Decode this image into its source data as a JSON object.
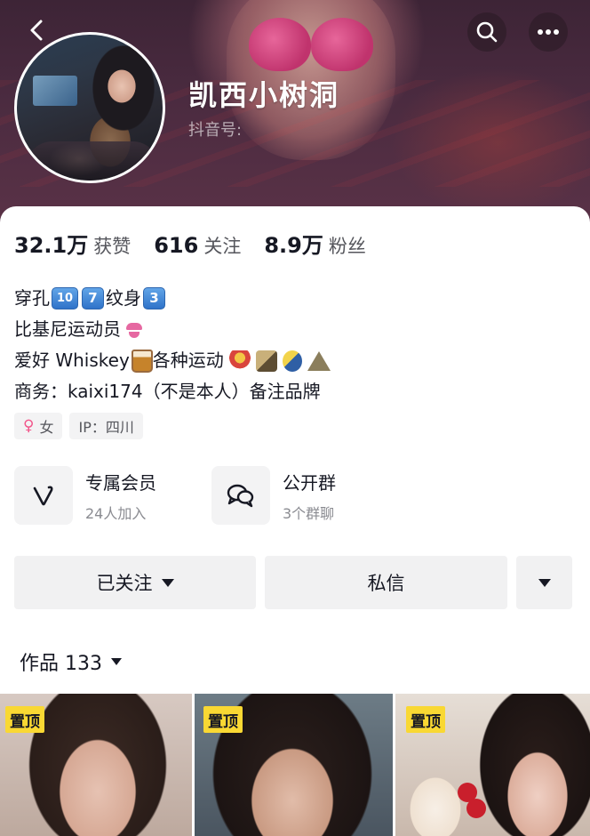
{
  "header": {
    "nickname": "凯西小树洞",
    "douyin_id_label": "抖音号:",
    "icons": {
      "back": "back-icon",
      "search": "search-icon",
      "more": "more-icon"
    }
  },
  "stats": [
    {
      "num": "32.1万",
      "label": "获赞"
    },
    {
      "num": "616",
      "label": "关注"
    },
    {
      "num": "8.9万",
      "label": "粉丝"
    }
  ],
  "bio": {
    "line1": {
      "text_a": "穿孔",
      "key1": "10",
      "key2": "7",
      "text_b": "纹身",
      "key3": "3"
    },
    "line2": {
      "text": "比基尼运动员"
    },
    "line3": {
      "text_a": "爱好 Whiskey",
      "text_b": "各种运动"
    },
    "line4": {
      "text": "商务：kaixi174（不是本人）备注品牌"
    }
  },
  "tags": {
    "gender": "女",
    "ip": "IP：四川"
  },
  "features": {
    "member": {
      "title": "专属会员",
      "sub": "24人加入",
      "icon": "v-icon"
    },
    "group": {
      "title": "公开群",
      "sub": "3个群聊",
      "icon": "chat-bubbles-icon"
    }
  },
  "actions": {
    "followed": "已关注",
    "message": "私信"
  },
  "works": {
    "label": "作品 133"
  },
  "thumbnails": [
    {
      "badge": "置顶"
    },
    {
      "badge": "置顶"
    },
    {
      "badge": "置顶"
    }
  ],
  "colors": {
    "pin_badge": "#f9d833",
    "banner": "#4b2b40",
    "accent_female": "#f2558a"
  }
}
